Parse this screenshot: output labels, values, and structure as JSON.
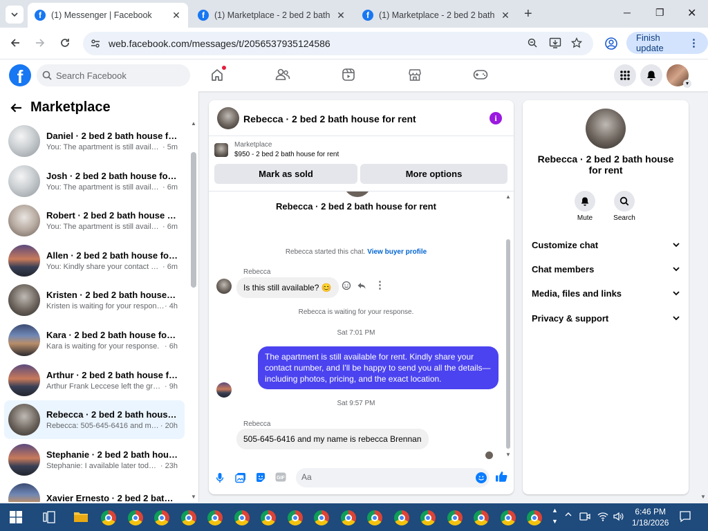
{
  "browser": {
    "tabs": [
      {
        "title": "(1) Messenger | Facebook",
        "active": true
      },
      {
        "title": "(1) Marketplace - 2 bed 2 bath house",
        "active": false
      },
      {
        "title": "(1) Marketplace - 2 bed 2 bath house",
        "active": false
      }
    ],
    "url": "web.facebook.com/messages/t/2056537935124586",
    "finish_update": "Finish update"
  },
  "fb": {
    "search_placeholder": "Search Facebook"
  },
  "sidebar": {
    "title": "Marketplace",
    "conversations": [
      {
        "name": "Daniel · 2 bed 2 bath house for ...",
        "preview": "You: The apartment is still availabl...",
        "time": " · 5m",
        "thumb": "th-a",
        "selected": false
      },
      {
        "name": "Josh · 2 bed 2 bath house for rent",
        "preview": "You: The apartment is still availabl...",
        "time": " · 6m",
        "thumb": "th-a",
        "selected": false
      },
      {
        "name": "Robert · 2 bed 2 bath house for ...",
        "preview": "You: The apartment is still availabl...",
        "time": " · 6m",
        "thumb": "th-b",
        "selected": false
      },
      {
        "name": "Allen · 2 bed 2 bath house for r...",
        "preview": "You: Kindly share your contact nu...",
        "time": " · 6m",
        "thumb": "th-c",
        "selected": false
      },
      {
        "name": "Kristen · 2 bed 2 bath house for...",
        "preview": "Kristen is waiting for your response.",
        "time": " · 4h",
        "thumb": "th-d",
        "selected": false
      },
      {
        "name": "Kara · 2 bed 2 bath house for rent",
        "preview": "Kara is waiting for your response.",
        "time": " · 6h",
        "thumb": "th-e",
        "selected": false
      },
      {
        "name": "Arthur · 2 bed 2 bath house for ...",
        "preview": "Arthur Frank Leccese left the group.",
        "time": " · 9h",
        "thumb": "th-c",
        "selected": false
      },
      {
        "name": "Rebecca · 2 bed 2 bath house fo...",
        "preview": "Rebecca: 505-645-6416 and my n...",
        "time": " · 20h",
        "thumb": "th-d",
        "selected": true
      },
      {
        "name": "Stephanie · 2 bed 2 bath house ...",
        "preview": "Stephanie: I available later today i...",
        "time": " · 23h",
        "thumb": "th-c",
        "selected": false
      },
      {
        "name": "Xavier Ernesto · 2 bed 2 bath ...",
        "preview": "",
        "time": "",
        "thumb": "th-e",
        "selected": false
      }
    ]
  },
  "chat": {
    "title": "Rebecca · 2 bed 2 bath house for rent",
    "listing_kind": "Marketplace",
    "listing_price": "$950 - 2 bed 2 bath house for rent",
    "mark_sold": "Mark as sold",
    "more_options": "More options",
    "intro_name": "Rebecca · 2 bed 2 bath house for rent",
    "started_text": "Rebecca started this chat.",
    "view_profile": "View buyer profile",
    "sender1": "Rebecca",
    "msg1": "Is this still available? 😊",
    "waiting_text": "Rebecca is waiting for your response.",
    "time1": "Sat 7:01 PM",
    "msg_out": "The apartment is still available for rent. Kindly share your contact number, and I'll be happy to send you all the details—including photos, pricing, and the exact location.",
    "time2": "Sat 9:57 PM",
    "sender2": "Rebecca",
    "msg2": "505-645-6416 and my  name is rebecca Brennan",
    "composer_placeholder": "Aa"
  },
  "info": {
    "name": "Rebecca · 2 bed 2 bath house for rent",
    "mute": "Mute",
    "search": "Search",
    "sections": [
      "Customize chat",
      "Chat members",
      "Media, files and links",
      "Privacy & support"
    ]
  },
  "taskbar": {
    "time": "6:46 PM",
    "date": "1/18/2026"
  }
}
